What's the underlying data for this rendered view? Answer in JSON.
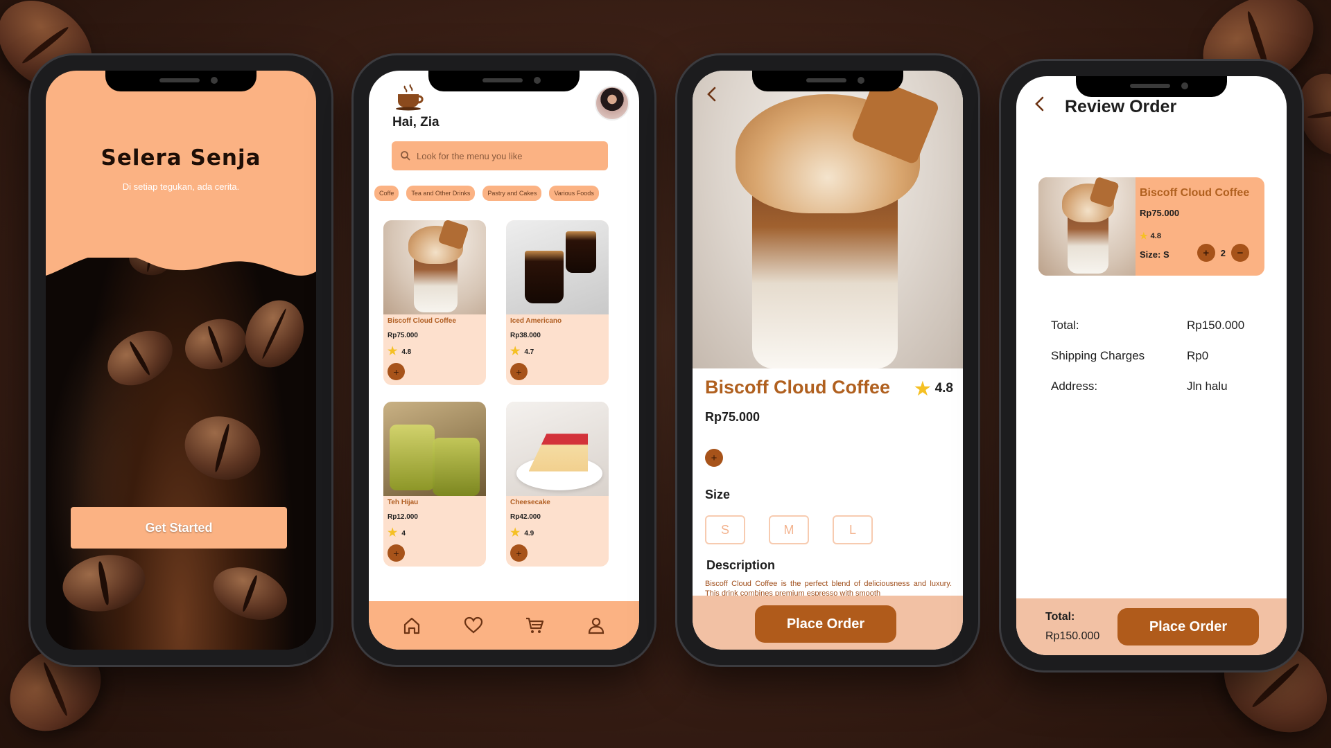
{
  "colors": {
    "accent_peach": "#fbb283",
    "accent_brown": "#b05b1b",
    "card_bg": "#fde0cd",
    "footer_bg": "#f2c1a4",
    "star": "#f5c023"
  },
  "splash": {
    "title": "Selera Senja",
    "subtitle": "Di setiap tegukan, ada cerita.",
    "cta_label": "Get Started"
  },
  "home": {
    "greeting": "Hai, Zia",
    "search_placeholder": "Look for the menu you like",
    "categories": [
      "Coffe",
      "Tea and Other Drinks",
      "Pastry and Cakes",
      "Various Foods"
    ],
    "products": [
      {
        "name": "Biscoff Cloud Coffee",
        "price": "Rp75.000",
        "rating": "4.8",
        "add_icon": "plus-icon"
      },
      {
        "name": "Iced Americano",
        "price": "Rp38.000",
        "rating": "4.7",
        "add_icon": "plus-icon"
      },
      {
        "name": "Teh Hijau",
        "price": "Rp12.000",
        "rating": "4",
        "add_icon": "plus-icon"
      },
      {
        "name": "Cheesecake",
        "price": "Rp42.000",
        "rating": "4.9",
        "add_icon": "plus-icon"
      }
    ],
    "nav": [
      "home-icon",
      "heart-icon",
      "cart-icon",
      "user-icon"
    ]
  },
  "detail": {
    "name": "Biscoff Cloud Coffee",
    "rating": "4.8",
    "price": "Rp75.000",
    "size_label": "Size",
    "sizes": [
      "S",
      "M",
      "L"
    ],
    "description_label": "Description",
    "description": "Biscoff Cloud Coffee is the perfect blend of deliciousness and luxury. This drink combines premium espresso with smooth",
    "order_label": "Place Order"
  },
  "review": {
    "title": "Review Order",
    "item": {
      "name": "Biscoff Cloud Coffee",
      "price": "Rp75.000",
      "rating": "4.8",
      "size": "Size: S",
      "quantity": "2"
    },
    "total_label": "Total:",
    "total_value": "Rp150.000",
    "shipping_label": "Shipping Charges",
    "shipping_value": "Rp0",
    "address_label": "Address:",
    "address_value": "Jln halu",
    "footer_total_label": "Total:",
    "footer_total_value": "Rp150.000",
    "order_label": "Place Order"
  }
}
